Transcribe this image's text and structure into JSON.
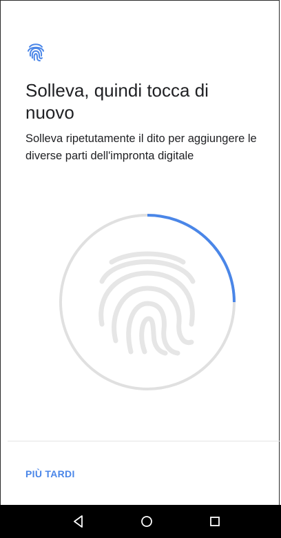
{
  "screen": {
    "title": "Solleva, quindi tocca di nuovo",
    "subtitle": "Solleva ripetutamente il dito per aggiungere le diverse parti dell'impronta digitale"
  },
  "enrollment": {
    "progress": 0.25,
    "progress_color": "#4a86e8",
    "track_color": "#e0e0e0",
    "fingerprint_color": "#e6e6e6"
  },
  "footer": {
    "later_label": "PIÙ TARDI"
  },
  "icons": {
    "header": "fingerprint-icon",
    "progress_center": "fingerprint-icon",
    "nav_back": "back-triangle-icon",
    "nav_home": "home-circle-icon",
    "nav_recents": "recents-square-icon"
  },
  "colors": {
    "accent": "#4a86e8",
    "text": "#202124",
    "navbar": "#000000"
  }
}
